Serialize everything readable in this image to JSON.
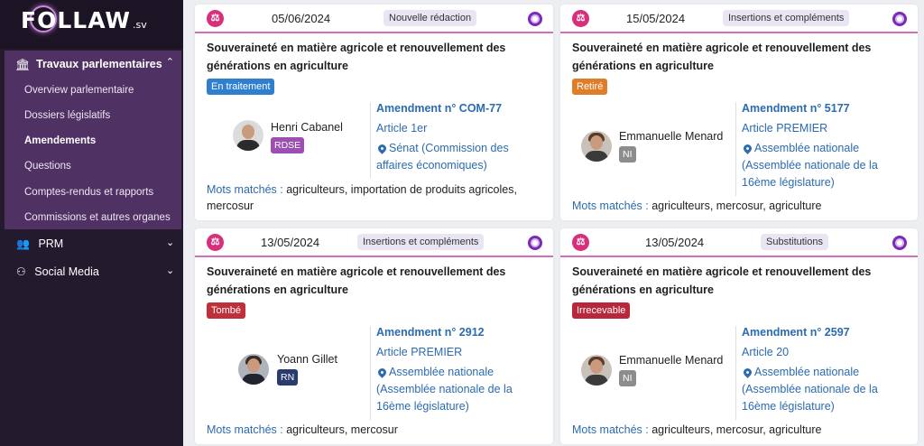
{
  "app": {
    "logo": "FOLLAW",
    "logo_suffix": ".sv"
  },
  "sidebar": {
    "section": {
      "label": "Travaux parlementaires",
      "icon": "bank-icon",
      "expanded": true
    },
    "sub_items": [
      {
        "label": "Overview parlementaire",
        "active": false
      },
      {
        "label": "Dossiers législatifs",
        "active": false
      },
      {
        "label": "Amendements",
        "active": true
      },
      {
        "label": "Questions",
        "active": false
      },
      {
        "label": "Comptes-rendus et rapports",
        "active": false
      },
      {
        "label": "Commissions et autres organes",
        "active": false
      }
    ],
    "items": [
      {
        "label": "PRM",
        "icon": "people-icon"
      },
      {
        "label": "Social Media",
        "icon": "network-icon"
      }
    ]
  },
  "cards": [
    {
      "date": "05/06/2024",
      "tag": "Nouvelle rédaction",
      "title": "Souveraineté en matière agricole et renouvellement des générations en agriculture",
      "status": "En traitement",
      "status_color": "#2f7fd1",
      "person": {
        "name": "Henri Cabanel",
        "group": "RDSE",
        "group_color": "#9b4fb0"
      },
      "amendment": "Amendment n° COM-77",
      "article": "Article 1er",
      "location": "Sénat (Commission des affaires économiques)",
      "mots_label": "Mots matchés :",
      "mots": "agriculteurs, importation de produits agricoles, mercosur"
    },
    {
      "date": "15/05/2024",
      "tag": "Insertions et compléments",
      "title": "Souveraineté en matière agricole et renouvellement des générations en agriculture",
      "status": "Retiré",
      "status_color": "#e07d28",
      "person": {
        "name": "Emmanuelle Menard",
        "group": "NI",
        "group_color": "#8c8c8c"
      },
      "amendment": "Amendment n° 5177",
      "article": "Article PREMIER",
      "location": "Assemblée nationale (Assemblée nationale de la 16ème législature)",
      "mots_label": "Mots matchés :",
      "mots": "agriculteurs, mercosur, agriculture"
    },
    {
      "date": "13/05/2024",
      "tag": "Insertions et compléments",
      "title": "Souveraineté en matière agricole et renouvellement des générations en agriculture",
      "status": "Tombé",
      "status_color": "#c0303a",
      "person": {
        "name": "Yoann Gillet",
        "group": "RN",
        "group_color": "#2a3b6e"
      },
      "amendment": "Amendment n° 2912",
      "article": "Article PREMIER",
      "location": "Assemblée nationale (Assemblée nationale de la 16ème législature)",
      "mots_label": "Mots matchés :",
      "mots": "agriculteurs, mercosur"
    },
    {
      "date": "13/05/2024",
      "tag": "Substitutions",
      "title": "Souveraineté en matière agricole et renouvellement des générations en agriculture",
      "status": "Irrecevable",
      "status_color": "#b8283a",
      "person": {
        "name": "Emmanuelle Menard",
        "group": "NI",
        "group_color": "#8c8c8c"
      },
      "amendment": "Amendment n° 2597",
      "article": "Article 20",
      "location": "Assemblée nationale (Assemblée nationale de la 16ème législature)",
      "mots_label": "Mots matchés :",
      "mots": "agriculteurs, mercosur, agriculture"
    }
  ]
}
